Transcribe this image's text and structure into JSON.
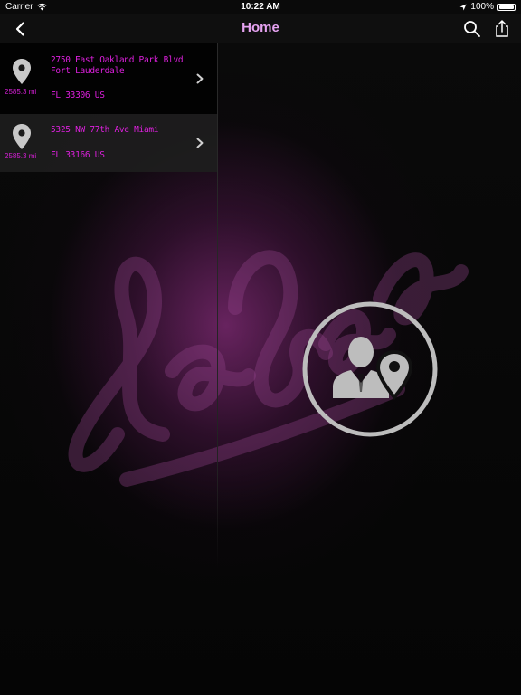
{
  "status_bar": {
    "carrier": "Carrier",
    "time": "10:22 AM",
    "battery": "100%"
  },
  "nav": {
    "title": "Home",
    "back_icon": "chevron-left-icon",
    "search_icon": "search-icon",
    "share_icon": "share-icon"
  },
  "locations": [
    {
      "distance": "2585.3 mi",
      "line1": "2750 East Oakland Park Blvd",
      "line2": "Fort Lauderdale",
      "line3": "FL 33306 US"
    },
    {
      "distance": "2585.3 mi",
      "line1": "5325 NW 77th Ave Miami",
      "line3": "FL 33166 US"
    }
  ],
  "center_icon": "user-location-icon",
  "colors": {
    "accent": "#dd20dd",
    "title": "#e5a2f0",
    "icon_gray": "#bdbdbd"
  }
}
